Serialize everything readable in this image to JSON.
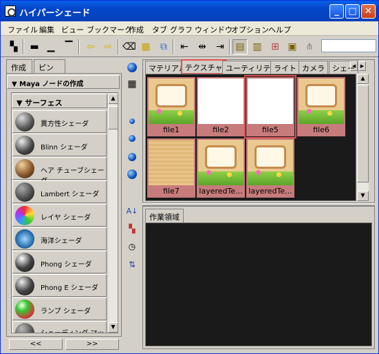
{
  "window": {
    "title": "ハイパーシェード",
    "minimize_label": "_",
    "maximize_label": "□",
    "close_label": "✕"
  },
  "menu": [
    "ファイル",
    "編集",
    "ビュー",
    "ブックマーク",
    "作成",
    "タブ",
    "グラフ",
    "ウィンドウ",
    "オプション",
    "ヘルプ"
  ],
  "left": {
    "tabs": [
      "作成",
      "ピン"
    ],
    "header": "Maya ノードの作成",
    "section": "サーフェス",
    "nodes": [
      {
        "label": "異方性シェーダ",
        "color": "#5a5a5a"
      },
      {
        "label": "Blinn シェーダ",
        "color": "#4a4a4a"
      },
      {
        "label": "ヘア チューブシェーダ",
        "color": "#8a5a2a"
      },
      {
        "label": "Lambert シェーダ",
        "color": "#4e4e4e"
      },
      {
        "label": "レイヤ シェーダ",
        "color": "#8a7ad8"
      },
      {
        "label": "海洋シェーダ",
        "color": "#2b6fb0"
      },
      {
        "label": "Phong シェーダ",
        "color": "#444444"
      },
      {
        "label": "Phong E シェーダ",
        "color": "#484848"
      },
      {
        "label": "ランプ シェーダ",
        "color": "#d03a3a"
      },
      {
        "label": "シェーディング マップ",
        "color": "#555555"
      }
    ],
    "nav_prev": "<<",
    "nav_next": ">>"
  },
  "right": {
    "tabs": [
      "マテリアル",
      "テクスチャ",
      "ユーティリティ",
      "ライト",
      "カメラ",
      "シェー"
    ],
    "active_tab": "テクスチャ",
    "textures": [
      {
        "name": "file1",
        "kind": "board"
      },
      {
        "name": "file2",
        "kind": "white"
      },
      {
        "name": "file5",
        "kind": "white",
        "selected": true
      },
      {
        "name": "file6",
        "kind": "board"
      },
      {
        "name": "file7",
        "kind": "wood"
      },
      {
        "name": "layeredTe...",
        "kind": "board"
      },
      {
        "name": "layeredTe...",
        "kind": "board"
      }
    ],
    "work_tab": "作業領域"
  },
  "colors": {
    "selection": "#e05050",
    "caption_bg": "#c77b7b",
    "titlebar": "#0446c9"
  }
}
